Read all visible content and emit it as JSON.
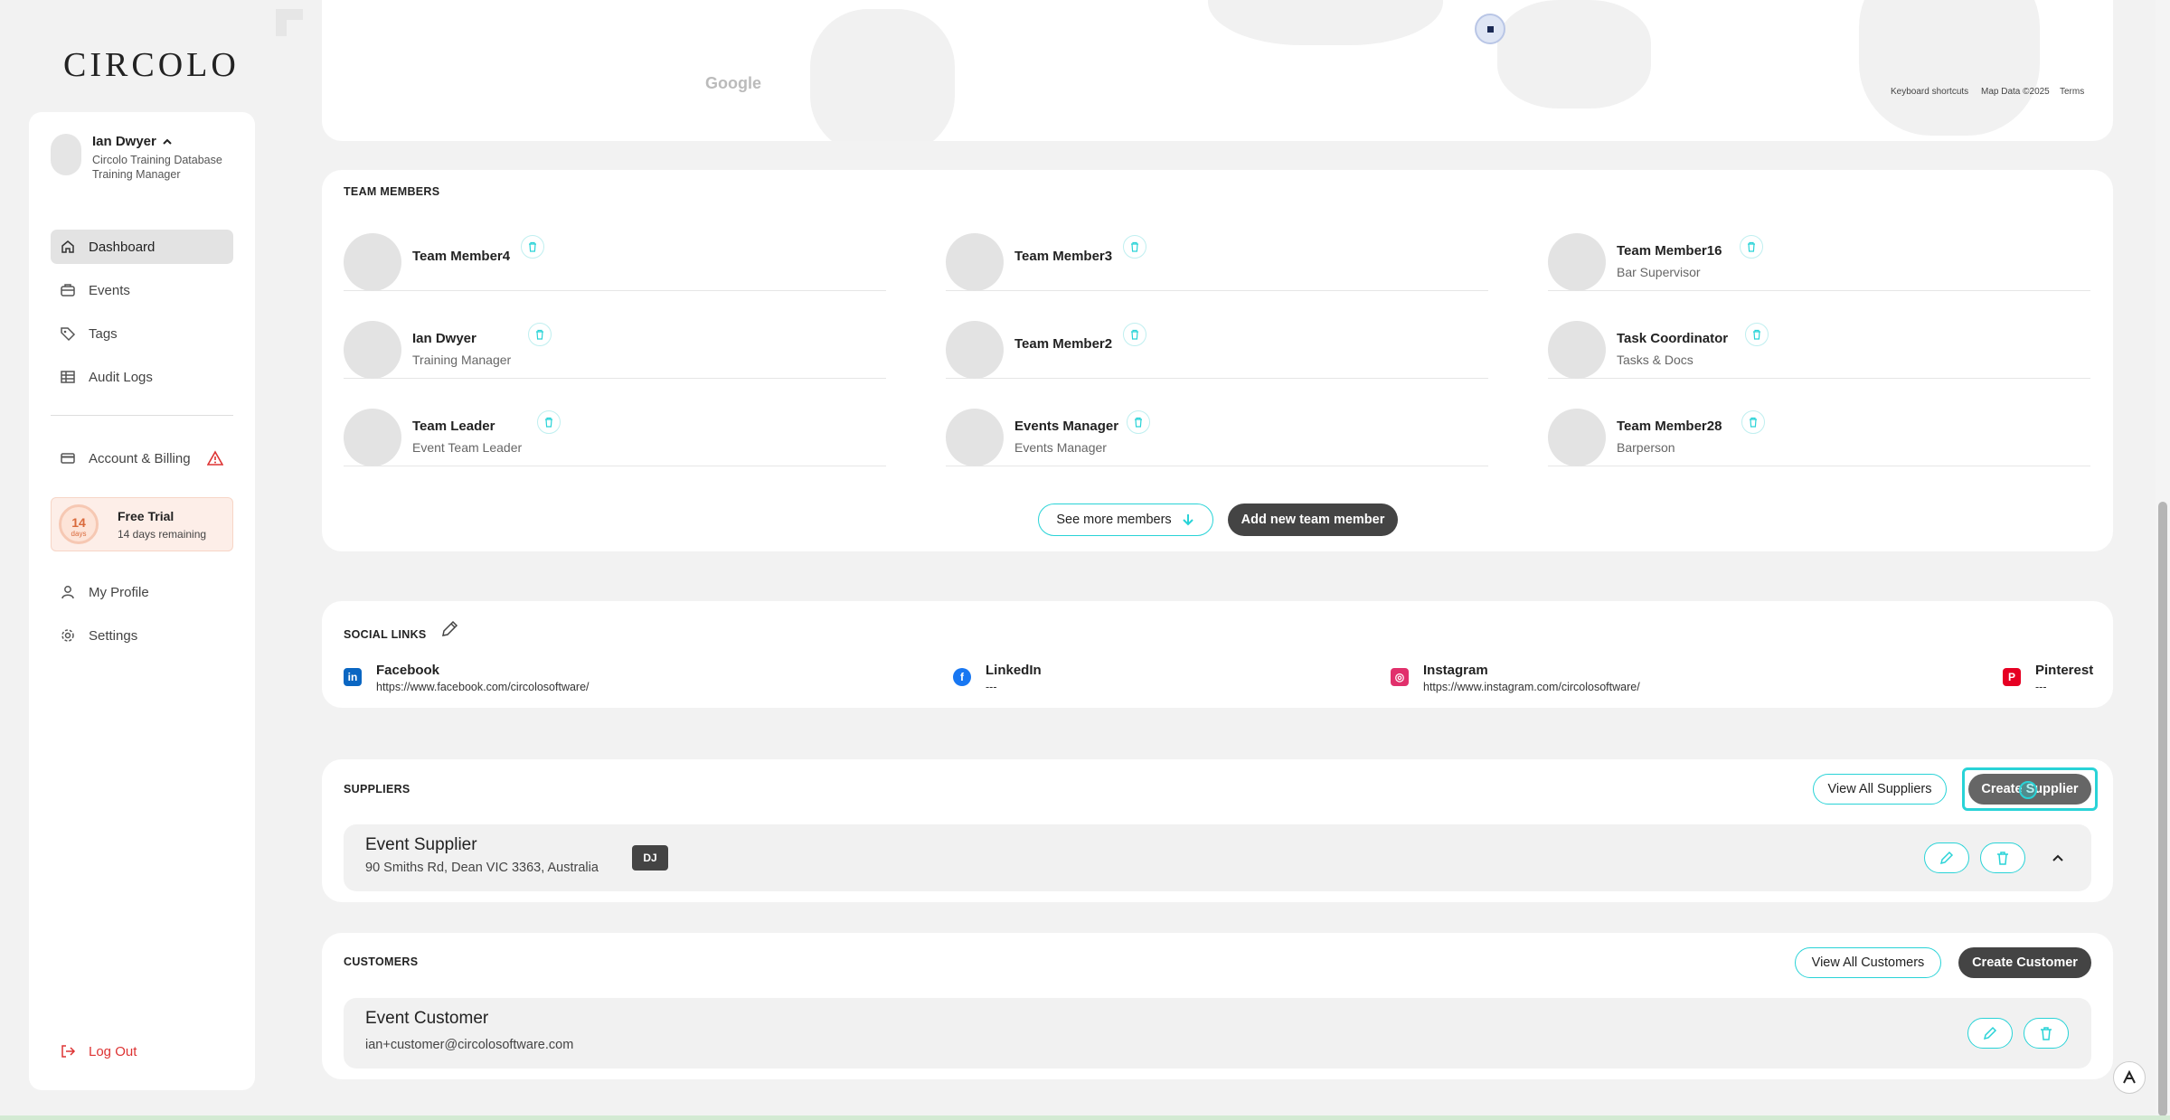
{
  "brand": {
    "logo_text": "CIRCOLO"
  },
  "user": {
    "name": "Ian Dwyer",
    "org": "Circolo Training Database",
    "role": "Training Manager"
  },
  "nav": {
    "items": [
      {
        "label": "Dashboard",
        "icon": "home-icon",
        "active": true
      },
      {
        "label": "Events",
        "icon": "briefcase-icon"
      },
      {
        "label": "Tags",
        "icon": "tag-icon"
      },
      {
        "label": "Audit Logs",
        "icon": "table-icon"
      }
    ],
    "billing": {
      "label": "Account & Billing",
      "icon": "credit-card-icon",
      "alert_icon": "warning-icon"
    },
    "trial": {
      "days": "14",
      "unit": "days",
      "title": "Free Trial",
      "subtitle": "14 days remaining"
    },
    "profile": {
      "label": "My Profile",
      "icon": "user-icon"
    },
    "settings": {
      "label": "Settings",
      "icon": "gear-icon"
    },
    "logout": {
      "label": "Log Out",
      "icon": "logout-icon"
    }
  },
  "map": {
    "attribution_logo": "Google",
    "shortcuts": "Keyboard shortcuts",
    "data": "Map Data ©2025",
    "terms": "Terms"
  },
  "team": {
    "title": "TEAM MEMBERS",
    "members": [
      {
        "name": "Team Member4",
        "role": ""
      },
      {
        "name": "Team Member3",
        "role": ""
      },
      {
        "name": "Team Member16",
        "role": "Bar Supervisor"
      },
      {
        "name": "Ian Dwyer",
        "role": "Training Manager"
      },
      {
        "name": "Team Member2",
        "role": ""
      },
      {
        "name": "Task Coordinator",
        "role": "Tasks & Docs"
      },
      {
        "name": "Team Leader",
        "role": "Event Team Leader"
      },
      {
        "name": "Events Manager",
        "role": "Events Manager"
      },
      {
        "name": "Team Member28",
        "role": "Barperson"
      }
    ],
    "see_more": "See more members",
    "add_new": "Add new team member"
  },
  "social": {
    "title": "SOCIAL LINKS",
    "links": [
      {
        "name": "Facebook",
        "url": "https://www.facebook.com/circolosoftware/",
        "icon": "linkedin-icon",
        "color": "#0a66c2"
      },
      {
        "name": "LinkedIn",
        "url": "---",
        "icon": "facebook-icon",
        "color": "#1877f2"
      },
      {
        "name": "Instagram",
        "url": "https://www.instagram.com/circolosoftware/",
        "icon": "instagram-icon",
        "color": "#e1306c"
      },
      {
        "name": "Pinterest",
        "url": "---",
        "icon": "pinterest-icon",
        "color": "#e60023"
      }
    ]
  },
  "suppliers": {
    "title": "SUPPLIERS",
    "view_all": "View All Suppliers",
    "create": "Create Supplier",
    "items": [
      {
        "name": "Event Supplier",
        "address": "90 Smiths Rd, Dean VIC 3363, Australia",
        "badge": "DJ"
      }
    ]
  },
  "customers": {
    "title": "CUSTOMERS",
    "view_all": "View All Customers",
    "create": "Create Customer",
    "items": [
      {
        "name": "Event Customer",
        "email": "ian+customer@circolosoftware.com"
      }
    ]
  },
  "colors": {
    "accent": "#29d3d7",
    "dark_button": "#444444",
    "danger": "#dd3333",
    "trial_bg": "#fdeee8"
  }
}
